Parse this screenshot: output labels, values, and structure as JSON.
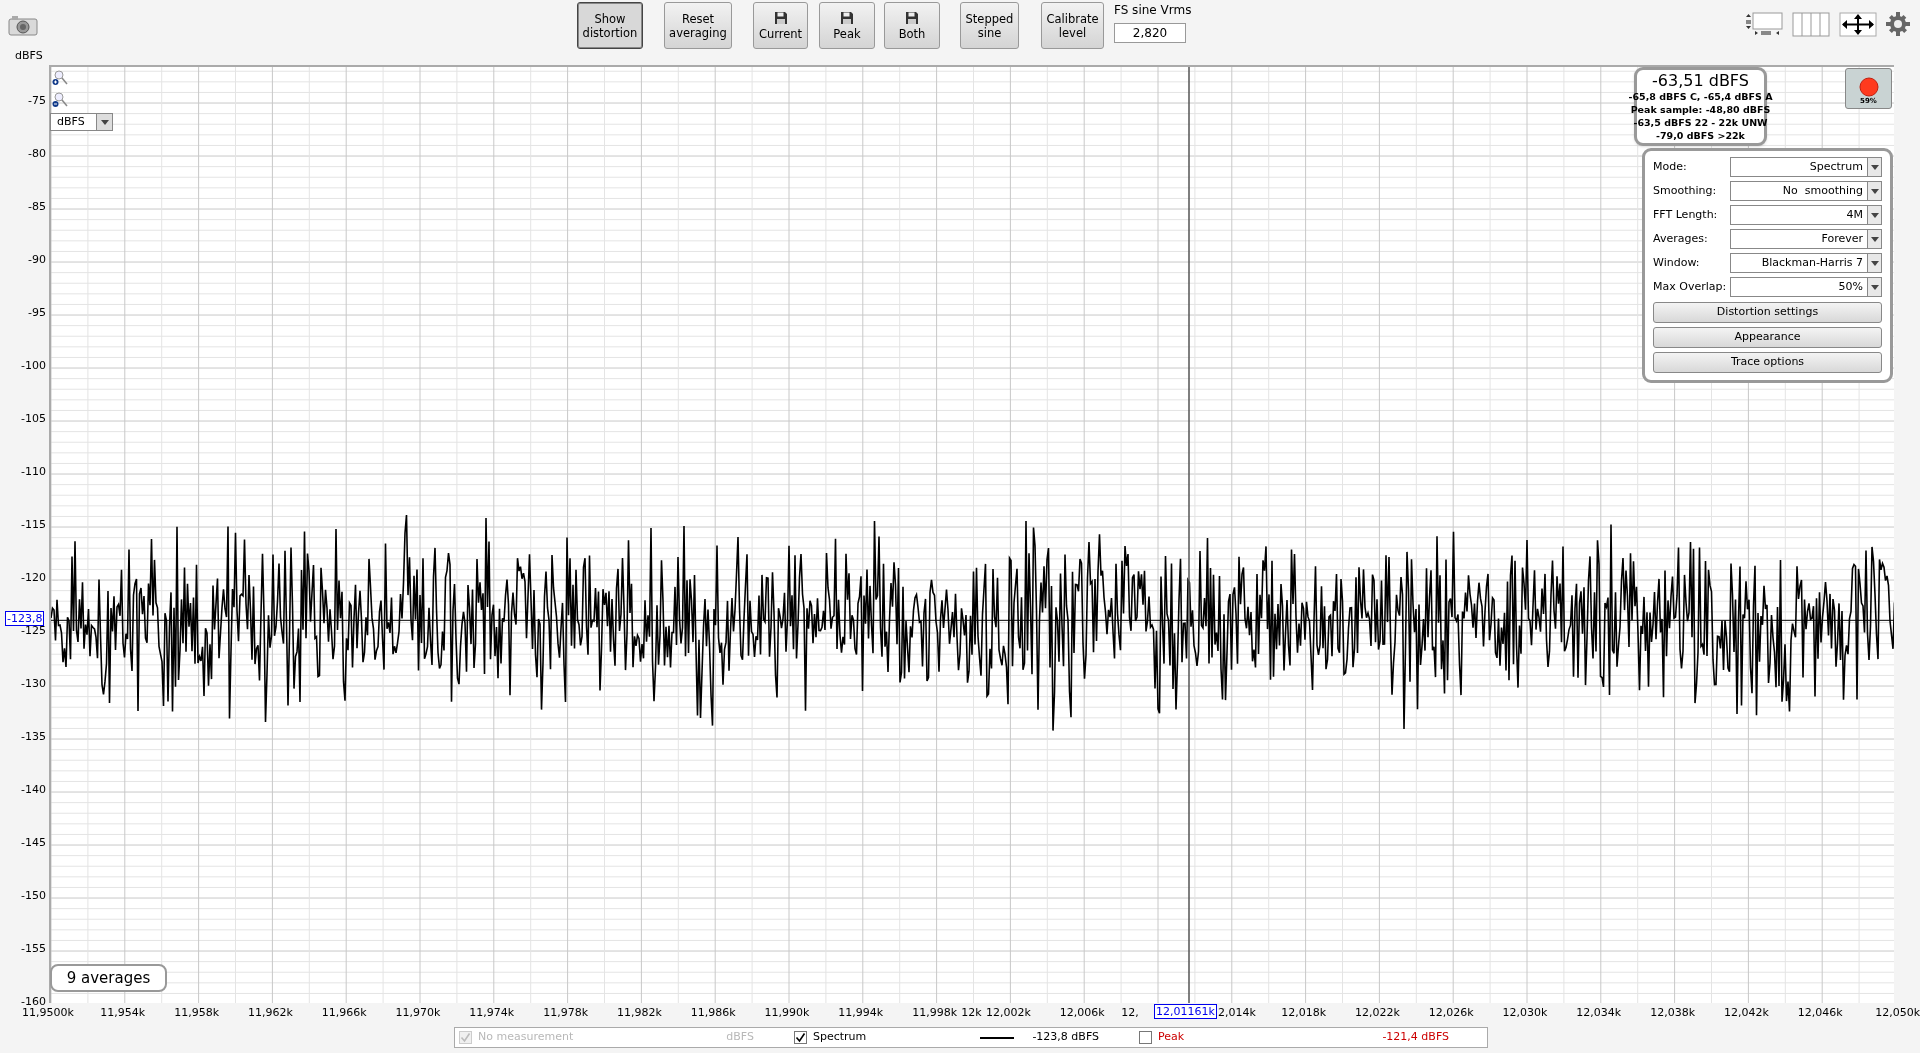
{
  "toolbar": {
    "buttons": [
      {
        "label": "Show\ndistortion",
        "kind": "text",
        "pressed": true
      },
      {
        "label": "Reset\naveraging",
        "kind": "text",
        "pressed": false
      },
      {
        "label": "Current",
        "kind": "save",
        "pressed": false
      },
      {
        "label": "Peak",
        "kind": "save",
        "pressed": false
      },
      {
        "label": "Both",
        "kind": "save",
        "pressed": false
      },
      {
        "label": "Stepped\nsine",
        "kind": "text",
        "pressed": false
      },
      {
        "label": "Calibrate\nlevel",
        "kind": "text",
        "pressed": false
      }
    ],
    "fs_sine": {
      "label": "FS sine Vrms",
      "value": "2,820"
    }
  },
  "chart": {
    "y_unit": "dBFS",
    "unit_select": "dBFS",
    "y_labels": [
      "-75",
      "-80",
      "-85",
      "-90",
      "-95",
      "-100",
      "-105",
      "-110",
      "-115",
      "-120",
      "-125",
      "-130",
      "-135",
      "-140",
      "-145",
      "-150",
      "-155",
      "-160"
    ],
    "x_labels": [
      "11,9500k",
      "11,954k",
      "11,958k",
      "11,962k",
      "11,966k",
      "11,970k",
      "11,974k",
      "11,978k",
      "11,982k",
      "11,986k",
      "11,990k",
      "11,994k",
      "11,998k",
      "12k",
      "12,002k",
      "12,006k",
      "12,",
      "2,014k",
      "12,018k",
      "12,022k",
      "12,026k",
      "12,030k",
      "12,034k",
      "12,038k",
      "12,042k",
      "12,046k",
      "12,050k"
    ],
    "y_cursor": "-123,8",
    "x_cursor": "12,01161k",
    "averages": "9 averages"
  },
  "readout": {
    "main": "-63,51 dBFS",
    "lines": [
      "-65,8 dBFS C, -65,4 dBFS A",
      "Peak sample: -48,80 dBFS",
      "-63,5 dBFS 22 - 22k UNW",
      "-79,0 dBFS >22k"
    ]
  },
  "record": {
    "percent": "59%"
  },
  "settings": {
    "rows": [
      {
        "label": "Mode:",
        "value": "Spectrum"
      },
      {
        "label": "Smoothing:",
        "value": "No  smoothing"
      },
      {
        "label": "FFT Length:",
        "value": "4M"
      },
      {
        "label": "Averages:",
        "value": "Forever"
      },
      {
        "label": "Window:",
        "value": "Blackman-Harris 7"
      },
      {
        "label": "Max Overlap:",
        "value": "50%"
      }
    ],
    "buttons": [
      "Distortion settings",
      "Appearance",
      "Trace options"
    ]
  },
  "legend": [
    {
      "label": "No measurement",
      "value": "dBFS",
      "checked": true,
      "disabled": true,
      "line": false,
      "color": "#b8b8b8"
    },
    {
      "label": "Spectrum",
      "value": "-123,8 dBFS",
      "checked": true,
      "disabled": false,
      "line": true,
      "color": "#000000"
    },
    {
      "label": "Peak",
      "value": "-121,4 dBFS",
      "checked": false,
      "disabled": false,
      "line": false,
      "color": "#cc0000"
    }
  ]
}
